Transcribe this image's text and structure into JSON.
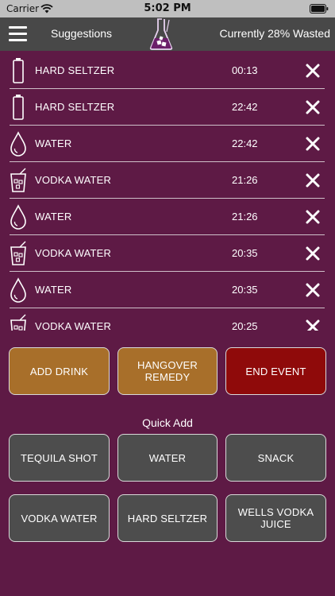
{
  "status_bar": {
    "carrier": "Carrier",
    "time": "5:02 PM"
  },
  "nav": {
    "suggestions_label": "Suggestions",
    "status_text": "Currently 28% Wasted"
  },
  "drinks": [
    {
      "name": "HARD SELTZER",
      "time": "00:13",
      "icon": "can-icon"
    },
    {
      "name": "HARD SELTZER",
      "time": "22:42",
      "icon": "can-icon"
    },
    {
      "name": "WATER",
      "time": "22:42",
      "icon": "water-drop-icon"
    },
    {
      "name": "VODKA WATER",
      "time": "21:26",
      "icon": "mixed-drink-glass-icon"
    },
    {
      "name": "WATER",
      "time": "21:26",
      "icon": "water-drop-icon"
    },
    {
      "name": "VODKA WATER",
      "time": "20:35",
      "icon": "mixed-drink-glass-icon"
    },
    {
      "name": "WATER",
      "time": "20:35",
      "icon": "water-drop-icon"
    },
    {
      "name": "VODKA WATER",
      "time": "20:25",
      "icon": "mixed-drink-glass-icon"
    }
  ],
  "actions": {
    "add_drink": "ADD DRINK",
    "hangover_line1": "HANGOVER",
    "hangover_line2": "REMEDY",
    "end_event": "END EVENT"
  },
  "quick_add": {
    "title": "Quick Add",
    "items": [
      {
        "line1": "TEQUILA SHOT",
        "line2": ""
      },
      {
        "line1": "WATER",
        "line2": ""
      },
      {
        "line1": "SNACK",
        "line2": ""
      },
      {
        "line1": "VODKA WATER",
        "line2": ""
      },
      {
        "line1": "HARD SELTZER",
        "line2": ""
      },
      {
        "line1": "WELLS VODKA",
        "line2": "JUICE"
      }
    ]
  },
  "colors": {
    "background": "#5e1a45",
    "nav_bar": "#484848",
    "orange_button": "#a86f2a",
    "red_button": "#8f0a0a",
    "grey_button": "#4d4d4d"
  }
}
